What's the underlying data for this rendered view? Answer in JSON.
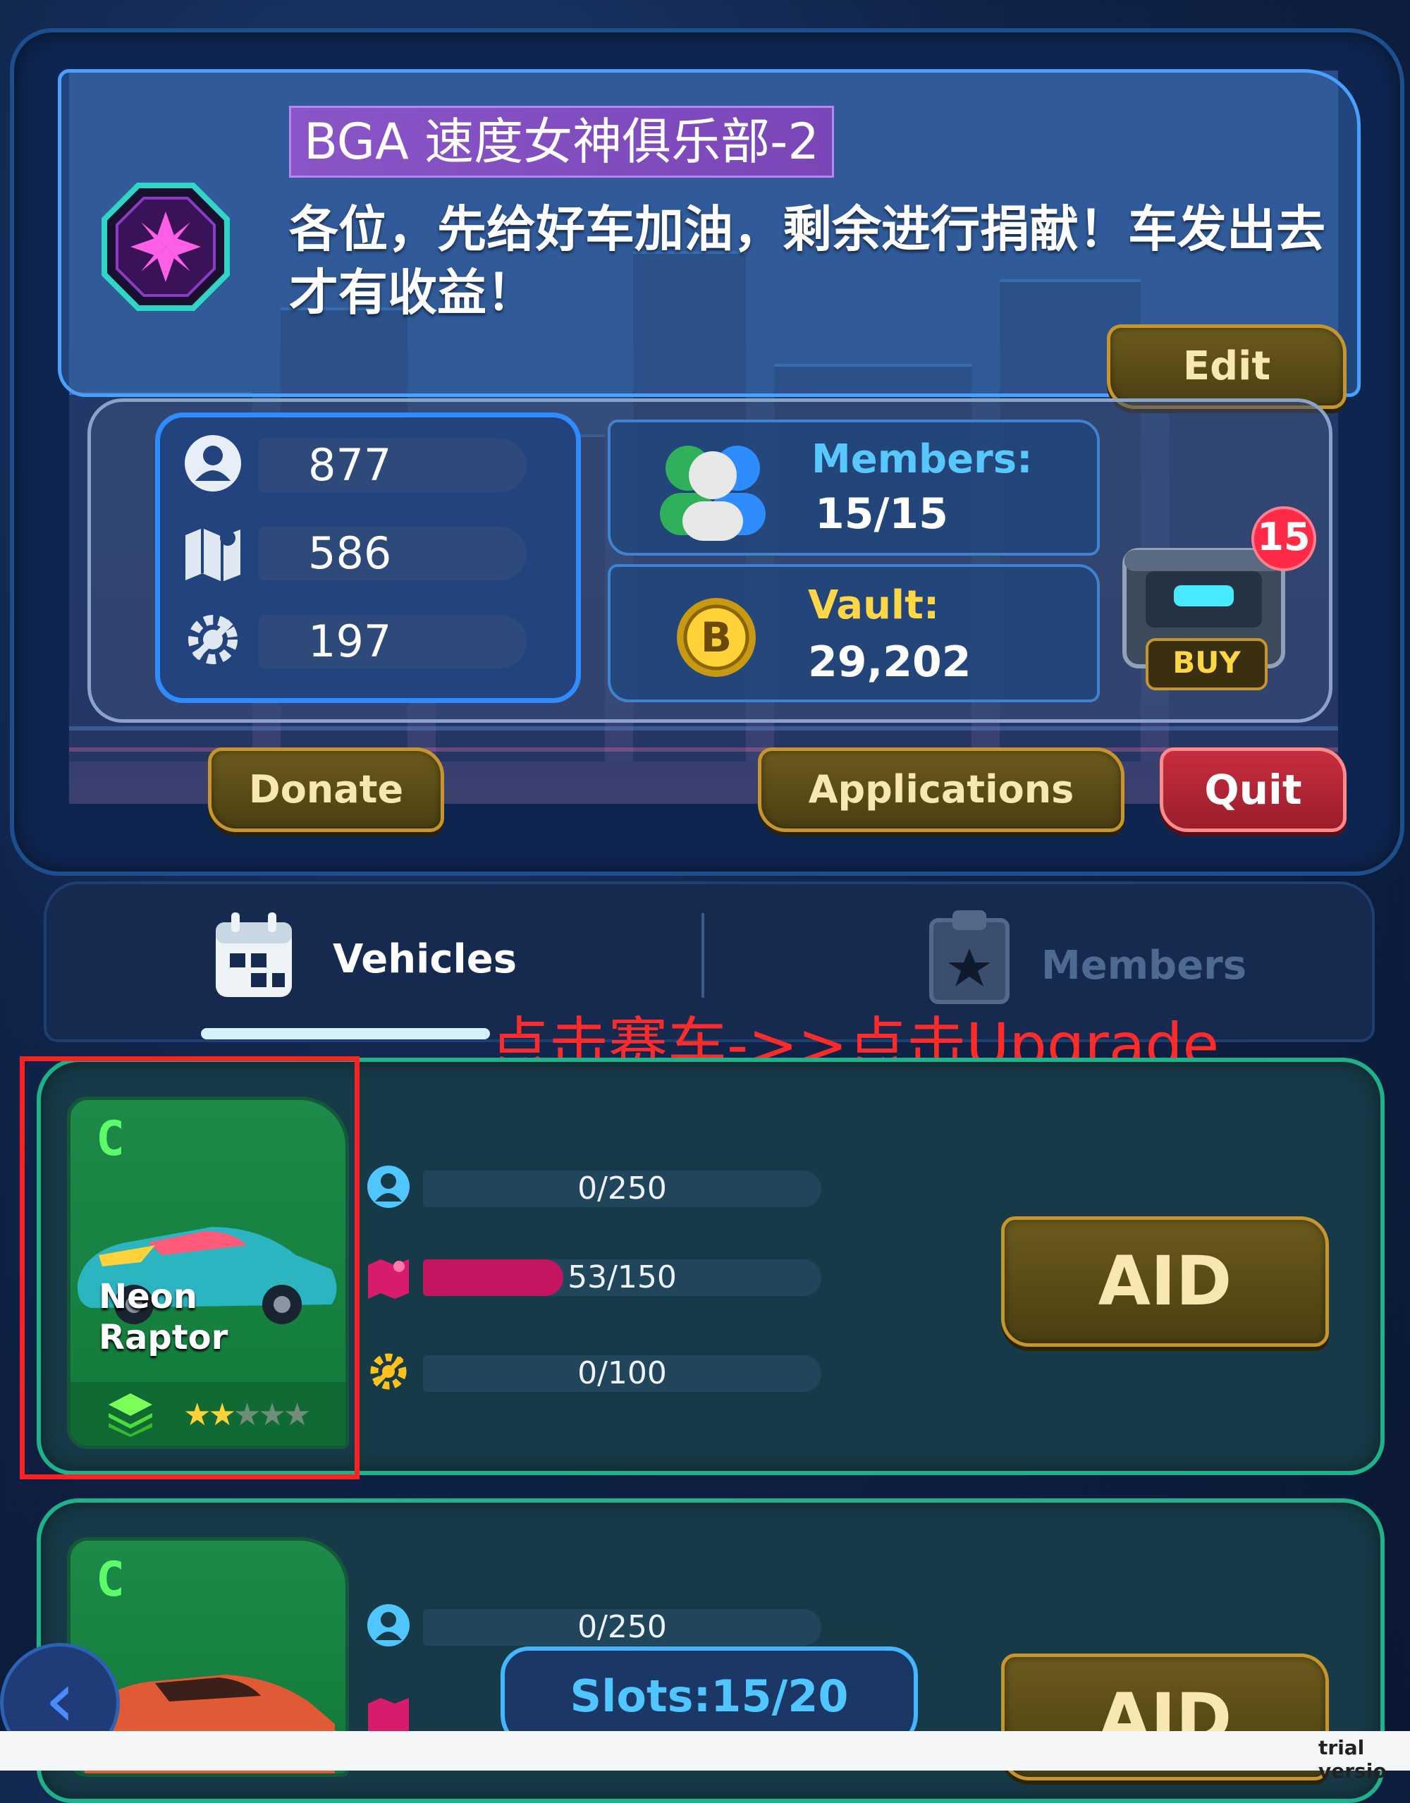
{
  "club": {
    "name": "BGA 速度女神俱乐部-2",
    "notice": "各位，先给好车加油，剩余进行捐献！车发出去才有收益！",
    "edit_label": "Edit",
    "stats": {
      "members_icon": "user-icon",
      "members_value": "877",
      "map_icon": "map-icon",
      "map_value": "586",
      "gear_icon": "gear-icon",
      "gear_value": "197"
    },
    "members_label": "Members:",
    "members_value": "15/15",
    "vault_label": "Vault:",
    "vault_value": "29,202",
    "chest_badge": "15",
    "buy_label": "BUY",
    "donate_label": "Donate",
    "applications_label": "Applications",
    "quit_label": "Quit"
  },
  "tabs": [
    {
      "label": "Vehicles",
      "icon": "calendar-icon",
      "active": true
    },
    {
      "label": "Members",
      "icon": "clipboard-star-icon",
      "active": false
    }
  ],
  "annotation": "点击赛车->>点击Upgrade",
  "vehicles": [
    {
      "rarity": "C",
      "name_line1": "Neon",
      "name_line2": "Raptor",
      "stars_filled": 2,
      "stars_total": 5,
      "stat1": "0/250",
      "stat2": "53/150",
      "stat2_fraction": 0.353,
      "stat3": "0/100",
      "aid_label": "AID"
    },
    {
      "rarity": "C",
      "stat1": "0/250",
      "aid_label": "AID"
    }
  ],
  "slots_label": "Slots:15/20",
  "back_icon": "chevron-left-icon",
  "trial_text": "trial versio",
  "colors": {
    "gold_button": "#c6962c",
    "quit_button": "#c82d3e",
    "accent_blue": "#2f8cff",
    "vehicle_border": "#1fb28a",
    "annotation_red": "#ff2020"
  }
}
